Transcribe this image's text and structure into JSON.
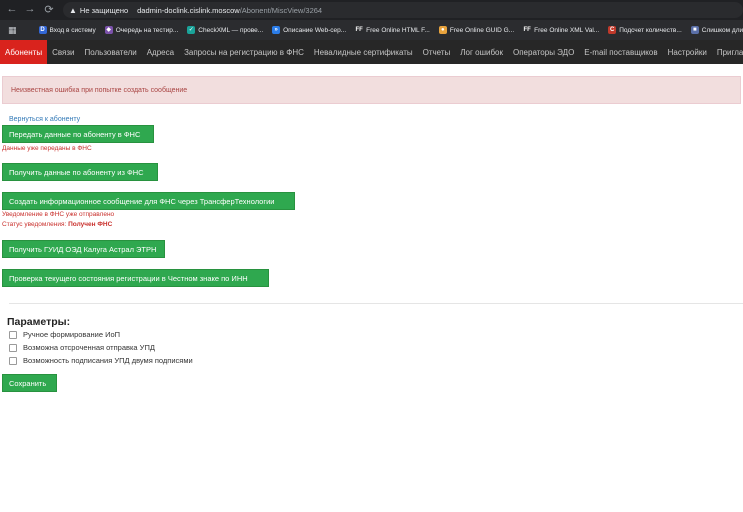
{
  "browser": {
    "nav": {
      "back": "←",
      "forward": "→",
      "reload": "⟳"
    },
    "address": {
      "warning_label": "Не защищено",
      "host": "dadmin-doclink.cislink.moscow",
      "path": "/Abonent/MiscView/3264"
    },
    "bookmarks": [
      {
        "label": "Вход в систему",
        "icon": "D",
        "color": "#3367d6"
      },
      {
        "label": "Очередь на тестир...",
        "icon": "◆",
        "color": "#7b52ab"
      },
      {
        "label": "CheckXML — прове...",
        "icon": "✓",
        "color": "#1aa39a"
      },
      {
        "label": "Описание Web-сер...",
        "icon": "»",
        "color": "#2b7de9"
      },
      {
        "label": "Free Online HTML F...",
        "icon": "FF",
        "color": "#2b2c2f"
      },
      {
        "label": "Free Online GUID G...",
        "icon": "●",
        "color": "#e8a33d"
      },
      {
        "label": "Free Online XML Val...",
        "icon": "FF",
        "color": "#2b2c2f"
      },
      {
        "label": "Подсчет количеств...",
        "icon": "C",
        "color": "#c0392b"
      },
      {
        "label": "Слишком длинны...",
        "icon": "■",
        "color": "#5a6fa8"
      }
    ]
  },
  "nav": {
    "tabs": [
      {
        "label": "Абоненты",
        "active": true
      },
      {
        "label": "Связи",
        "active": false
      },
      {
        "label": "Пользователи",
        "active": false
      },
      {
        "label": "Адреса",
        "active": false
      },
      {
        "label": "Запросы на регистрацию в ФНС",
        "active": false
      },
      {
        "label": "Невалидные сертификаты",
        "active": false
      },
      {
        "label": "Отчеты",
        "active": false
      },
      {
        "label": "Лог ошибок",
        "active": false
      },
      {
        "label": "Операторы ЭДО",
        "active": false
      },
      {
        "label": "E-mail поставщиков",
        "active": false
      },
      {
        "label": "Настройки",
        "active": false
      },
      {
        "label": "Пригла",
        "active": false
      }
    ]
  },
  "alert": {
    "text": "Неизвестная ошибка при попытке создать сообщение"
  },
  "back_link": "Вернуться к абоненту",
  "actions": {
    "send_fns": "Передать данные по абоненту в ФНС",
    "sent_note": "Данные уже переданы в ФНС",
    "get_fns": "Получить данные по абоненту из ФНС",
    "create_message": "Создать информационное сообщение для ФНС через ТрансферТехнологии",
    "notice_sent": "Уведомление в ФНС уже отправлено",
    "status_label": "Статус уведомления:",
    "status_value": "Получен ФНС",
    "get_guid": "Получить ГУИД ОЭД Калуга Астрал ЭТРН",
    "check_state": "Проверка текущего состояния регистрации в Честном знаке по ИНН"
  },
  "params": {
    "title": "Параметры:",
    "options": [
      {
        "label": "Ручное формирование ИоП",
        "checked": false
      },
      {
        "label": "Возможна отсроченная отправка УПД",
        "checked": false
      },
      {
        "label": "Возможность подписания УПД двумя подписями",
        "checked": false
      }
    ],
    "save_label": "Сохранить"
  }
}
